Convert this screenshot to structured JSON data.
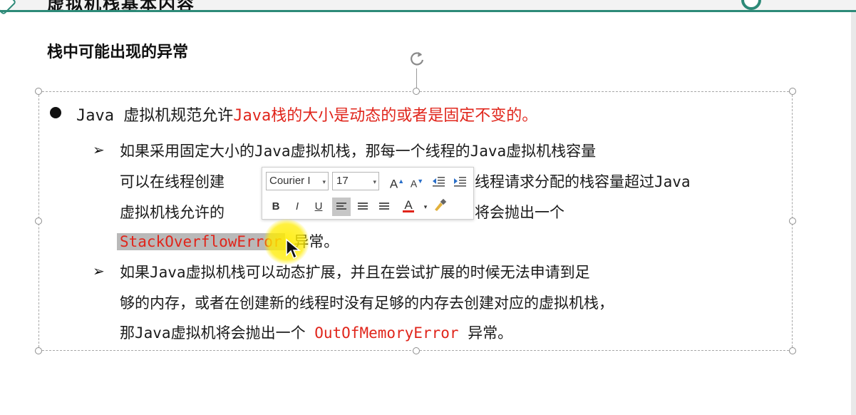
{
  "slide": {
    "title": "虚拟机栈基本内容",
    "heading": "栈中可能出现的异常"
  },
  "bullet": {
    "prefix": "Java 虚拟机规范允许",
    "red_text": "Java栈的大小是动态的或者是固定不变的。"
  },
  "sub1": {
    "line1": "如果采用固定大小的Java虚拟机栈，那每一个线程的Java虚拟机栈容量",
    "line2_start": "可以在线程创建",
    "line2_end": "线程请求分配的栈容量超过Java",
    "line3_start": "虚拟机栈允许的",
    "line3_end": "将会抛出一个",
    "error_name": "StackOverflowError",
    "suffix": "异常。"
  },
  "sub2": {
    "line1": "如果Java虚拟机栈可以动态扩展，并且在尝试扩展的时候无法申请到足",
    "line2": "够的内存，或者在创建新的线程时没有足够的内存去创建对应的虚拟机栈，",
    "line3_start": "那Java虚拟机将会抛出一个",
    "error_name": "OutOfMemoryError",
    "suffix": "异常。"
  },
  "mini_toolbar": {
    "font_name": "Courier I",
    "font_size": "17",
    "grow_font_label": "A",
    "shrink_font_label": "A",
    "bold_label": "B",
    "italic_label": "I",
    "underline_label": "U",
    "font_color_label": "A"
  },
  "colors": {
    "accent": "#2d8a78",
    "highlight_red": "#e0251b",
    "selection_gray": "#b9b9b9"
  }
}
